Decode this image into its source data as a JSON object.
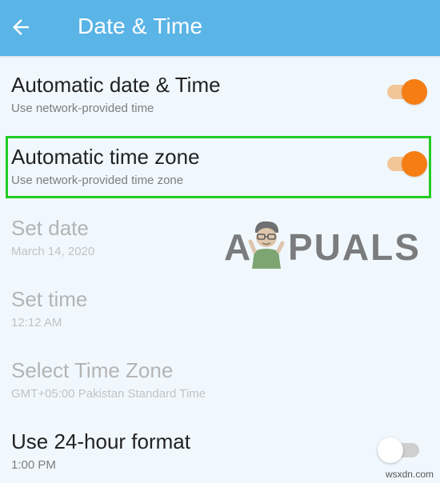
{
  "header": {
    "title": "Date & Time",
    "back_icon": "arrow-left-icon",
    "background": "#5ab4e6"
  },
  "settings": [
    {
      "title": "Automatic date & Time",
      "subtitle": "Use network-provided time",
      "toggle": "on",
      "enabled": true
    },
    {
      "title": "Automatic time zone",
      "subtitle": "Use network-provided time zone",
      "toggle": "on",
      "enabled": true,
      "highlighted": true
    },
    {
      "title": "Set date",
      "subtitle": "March 14, 2020",
      "enabled": false
    },
    {
      "title": "Set time",
      "subtitle": "12:12 AM",
      "enabled": false
    },
    {
      "title": "Select Time Zone",
      "subtitle": "GMT+05:00 Pakistan Standard Time",
      "enabled": false
    },
    {
      "title": "Use 24-hour format",
      "subtitle": "1:00 PM",
      "toggle": "off",
      "enabled": true
    }
  ],
  "colors": {
    "accent_orange": "#f57d13",
    "highlight_green": "#22cc22",
    "page_background": "#f0f8fe"
  },
  "watermark": {
    "left_letter": "A",
    "right_letters": "PUALS"
  },
  "source_watermark": "wsxdn.com"
}
